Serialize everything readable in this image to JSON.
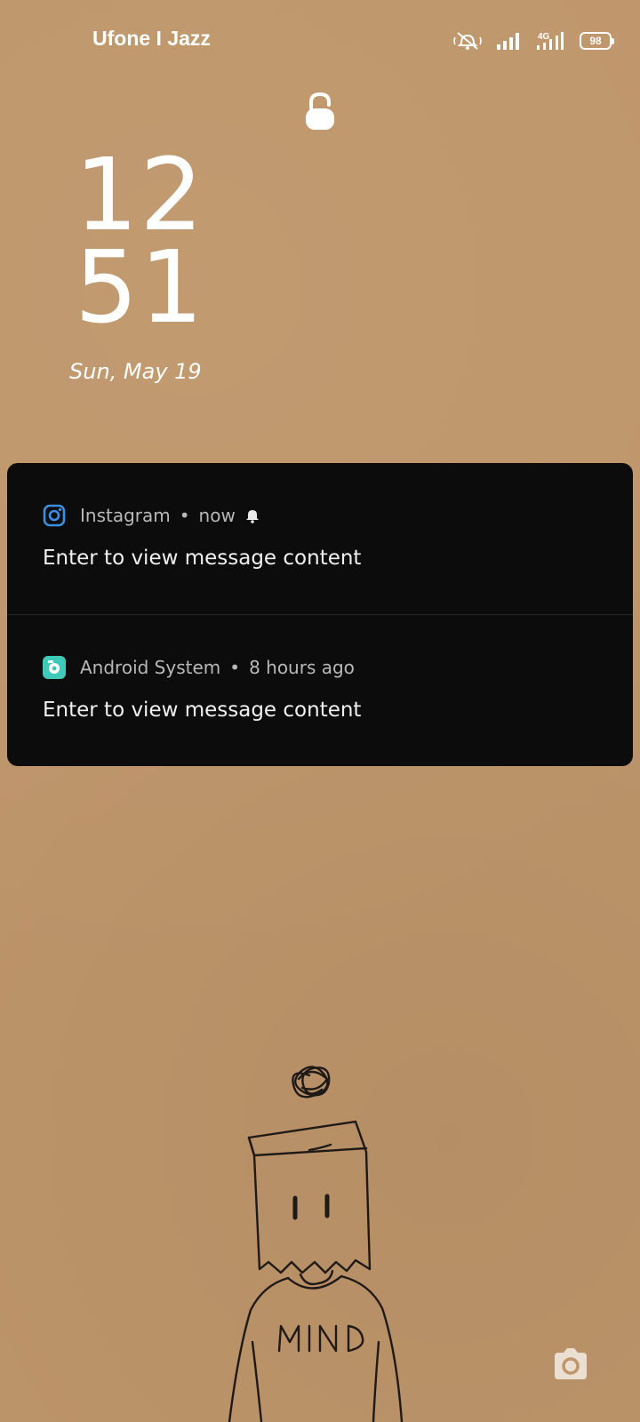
{
  "status_bar": {
    "carrier": "Ufone I Jazz",
    "network_type": "4G",
    "battery_level": "98",
    "icons": [
      "mute-icon",
      "signal-icon",
      "signal-4g-icon",
      "battery-icon"
    ]
  },
  "lock": {
    "icon": "lock-icon"
  },
  "clock": {
    "hour": "12",
    "minute": "51",
    "date": "Sun, May 19"
  },
  "notifications": [
    {
      "app_name": "Instagram",
      "separator": "•",
      "time": "now",
      "icon": "instagram-icon",
      "has_bell": true,
      "body": "Enter to view message content"
    },
    {
      "app_name": "Android System",
      "separator": "•",
      "time": "8 hours ago",
      "icon": "android-system-icon",
      "has_bell": false,
      "body": "Enter to view message content"
    }
  ],
  "shortcuts": {
    "camera_icon": "camera-icon"
  },
  "wallpaper": {
    "shirt_text": "MIND"
  },
  "colors": {
    "background": "#bf966b",
    "notification_panel": "#0c0c0d",
    "instagram_blue": "#3b8fe0",
    "android_system_teal": "#3fc9b8"
  }
}
